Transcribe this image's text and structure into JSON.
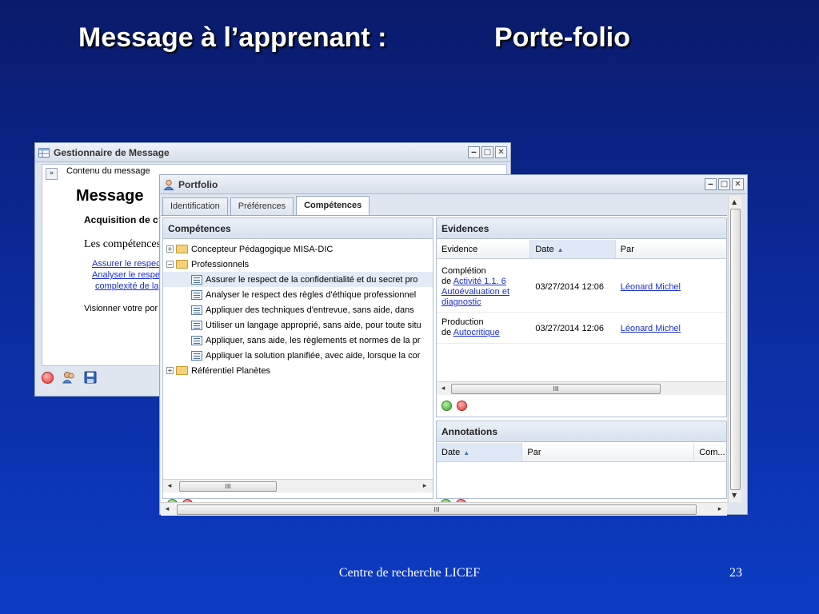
{
  "slide": {
    "title_left": "Message à l’apprenant :",
    "title_right": "Porte-folio",
    "footer": "Centre de recherche LICEF",
    "page_number": "23"
  },
  "message_window": {
    "title": "Gestionnaire de Message",
    "header": "Contenu du message",
    "heading": "Message",
    "subheading": "Acquisition de c",
    "competences_label": "Les compétences",
    "links": [
      "Assurer le respec",
      "Analyser le respe",
      "complexité de la"
    ],
    "visit_text": "Visionner votre por"
  },
  "portfolio_window": {
    "title": "Portfolio",
    "tabs": [
      {
        "label": "Identification",
        "active": false
      },
      {
        "label": "Préférences",
        "active": false
      },
      {
        "label": "Compétences",
        "active": true
      }
    ],
    "competences": {
      "header": "Compétences",
      "tree": [
        {
          "label": "Concepteur Pédagogique MISA-DIC",
          "type": "folder",
          "expander": "+"
        },
        {
          "label": "Professionnels",
          "type": "folder",
          "expander": "−"
        },
        {
          "label": "Assurer le respect de la confidentialité et du secret pro",
          "type": "leaf",
          "selected": true
        },
        {
          "label": "Analyser le respect des règles d'éthique professionnel",
          "type": "leaf"
        },
        {
          "label": "Appliquer des techniques d'entrevue, sans aide, dans",
          "type": "leaf"
        },
        {
          "label": "Utiliser un langage approprié, sans aide, pour toute situ",
          "type": "leaf"
        },
        {
          "label": "Appliquer, sans aide, les règlements et normes de la pr",
          "type": "leaf"
        },
        {
          "label": "Appliquer la solution planifiée, avec aide, lorsque la cor",
          "type": "leaf"
        },
        {
          "label": "Référentiel Planètes",
          "type": "folder",
          "expander": "+"
        }
      ]
    },
    "evidences": {
      "header": "Evidences",
      "columns": [
        "Evidence",
        "Date",
        "Par"
      ],
      "rows": [
        {
          "evidence_line1": "Complétion",
          "evidence_prefix": "de",
          "evidence_link": "Activité 1.1. 6 Autoévaluation et diagnostic",
          "date": "03/27/2014 12:06",
          "par": "Léonard Michel"
        },
        {
          "evidence_line1": "Production",
          "evidence_prefix": "de",
          "evidence_link": "Autocritique",
          "date": "03/27/2014 12:06",
          "par": "Léonard Michel"
        }
      ]
    },
    "annotations": {
      "header": "Annotations",
      "columns": [
        "Date",
        "Par",
        "Com..."
      ]
    },
    "scroll_thumb_glyph": "III"
  },
  "colors": {
    "slide_bg_top": "#0a1a6a",
    "slide_bg_bottom": "#0c3cc4",
    "link": "#1a2fd0",
    "window_chrome": "#dfe6f0"
  }
}
